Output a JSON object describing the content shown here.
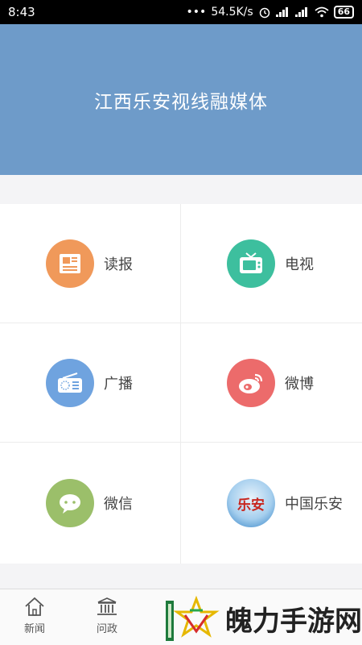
{
  "status_bar": {
    "time": "8:43",
    "speed": "54.5K/s",
    "battery": "66",
    "dots": "•••"
  },
  "banner": {
    "title": "江西乐安视线融媒体"
  },
  "grid": {
    "items": [
      {
        "label": "读报",
        "icon": "newspaper-icon",
        "color": "#f0995a"
      },
      {
        "label": "电视",
        "icon": "tv-icon",
        "color": "#3dbf9e"
      },
      {
        "label": "广播",
        "icon": "radio-icon",
        "color": "#6fa3df"
      },
      {
        "label": "微博",
        "icon": "weibo-icon",
        "color": "#ec6b6b"
      },
      {
        "label": "微信",
        "icon": "wechat-icon",
        "color": "#9bbf6a"
      },
      {
        "label": "中国乐安",
        "icon": "lean-logo-icon",
        "color": "#5aa7d8",
        "logo_text": "乐安"
      }
    ]
  },
  "bottom_nav": {
    "items": [
      {
        "label": "新闻",
        "icon": "home-icon"
      },
      {
        "label": "问政",
        "icon": "government-icon"
      }
    ]
  },
  "watermark": {
    "text": "魄力手游网"
  }
}
